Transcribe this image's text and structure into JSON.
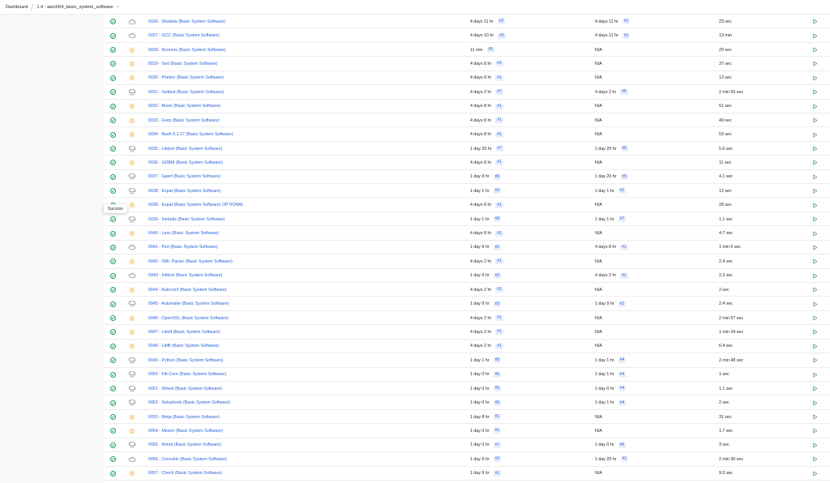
{
  "breadcrumb": {
    "items": [
      "Dashboard",
      "1.4 - aarch64_basic_system_software"
    ]
  },
  "tooltip": "Success",
  "colors": {
    "success": "#1f9d55",
    "link": "#2b62d8",
    "badge_bg": "#e8eefc"
  },
  "jobs": [
    {
      "name": "0026 - Shadow (Basic System Software)",
      "weather": "cloudy-icon",
      "last_success": "4 days 11 hr",
      "last_success_build": "#2",
      "last_failure": "4 days 11 hr",
      "last_failure_build": "#1",
      "last_duration": "23 sec"
    },
    {
      "name": "0027 - GCC (Basic System Software)",
      "weather": "cloudy-icon",
      "last_success": "4 days 10 hr",
      "last_success_build": "#3",
      "last_failure": "4 days 11 hr",
      "last_failure_build": "#1",
      "last_duration": "13 min"
    },
    {
      "name": "0028 - Ncurses (Basic System Software)",
      "weather": "sunny-icon",
      "last_success": "11 min",
      "last_success_build": "#5",
      "last_failure": "N/A",
      "last_failure_build": "",
      "last_duration": "29 sec"
    },
    {
      "name": "0029 - Sed (Basic System Software)",
      "weather": "sunny-icon",
      "last_success": "4 days 8 hr",
      "last_success_build": "#1",
      "last_failure": "N/A",
      "last_failure_build": "",
      "last_duration": "37 sec"
    },
    {
      "name": "0030 - Psmisc (Basic System Software)",
      "weather": "sunny-icon",
      "last_success": "4 days 8 hr",
      "last_success_build": "#1",
      "last_failure": "N/A",
      "last_failure_build": "",
      "last_duration": "13 sec"
    },
    {
      "name": "0031 - Gettext (Basic System Software)",
      "weather": "rainy-icon",
      "last_success": "4 days 2 hr",
      "last_success_build": "#7",
      "last_failure": "4 days 2 hr",
      "last_failure_build": "#5",
      "last_duration": "2 min 55 sec"
    },
    {
      "name": "0032 - Bison (Basic System Software)",
      "weather": "sunny-icon",
      "last_success": "4 days 8 hr",
      "last_success_build": "#1",
      "last_failure": "N/A",
      "last_failure_build": "",
      "last_duration": "51 sec"
    },
    {
      "name": "0033 - Grep (Basic System Software)",
      "weather": "sunny-icon",
      "last_success": "4 days 8 hr",
      "last_success_build": "#1",
      "last_failure": "N/A",
      "last_failure_build": "",
      "last_duration": "49 sec"
    },
    {
      "name": "0034 - Bash-5.2.37 (Basic System Software)",
      "weather": "sunny-icon",
      "last_success": "4 days 8 hr",
      "last_success_build": "#1",
      "last_failure": "N/A",
      "last_failure_build": "",
      "last_duration": "53 sec"
    },
    {
      "name": "0035 - Libtool (Basic System Software)",
      "weather": "rainy-icon",
      "last_success": "1 day 20 hr",
      "last_success_build": "#7",
      "last_failure": "1 day 20 hr",
      "last_failure_build": "#6",
      "last_duration": "5.6 sec"
    },
    {
      "name": "0036 - GDBM (Basic System Software)",
      "weather": "sunny-icon",
      "last_success": "4 days 8 hr",
      "last_success_build": "#1",
      "last_failure": "N/A",
      "last_failure_build": "",
      "last_duration": "11 sec"
    },
    {
      "name": "0037 - Gperf (Basic System Software)",
      "weather": "rainy-icon",
      "last_success": "1 day 9 hr",
      "last_success_build": "#6",
      "last_failure": "1 day 20 hr",
      "last_failure_build": "#5",
      "last_duration": "4.1 sec"
    },
    {
      "name": "0038 - Expat (Basic System Software)",
      "weather": "rainy-icon",
      "last_success": "1 day 1 hr",
      "last_success_build": "#3",
      "last_failure": "1 day 1 hr",
      "last_failure_build": "#2",
      "last_duration": "12 sec"
    },
    {
      "name": "0038 - Expat (Basic System Software) OPTIONAL",
      "weather": "sunny-icon",
      "last_success": "4 days 8 hr",
      "last_success_build": "#1",
      "last_failure": "N/A",
      "last_failure_build": "",
      "last_duration": "28 sec"
    },
    {
      "name": "0039 - Inetutils (Basic System Software)",
      "weather": "rainy-icon",
      "last_success": "1 day 1 hr",
      "last_success_build": "#8",
      "last_failure": "1 day 1 hr",
      "last_failure_build": "#7",
      "last_duration": "1.1 sec"
    },
    {
      "name": "0040 - Less (Basic System Software)",
      "weather": "sunny-icon",
      "last_success": "4 days 8 hr",
      "last_success_build": "#1",
      "last_failure": "N/A",
      "last_failure_build": "",
      "last_duration": "4.7 sec"
    },
    {
      "name": "0041 - Perl (Basic System Software)",
      "weather": "cloudy-icon",
      "last_success": "1 day 9 hr",
      "last_success_build": "#2",
      "last_failure": "4 days 8 hr",
      "last_failure_build": "#1",
      "last_duration": "1 min 6 sec"
    },
    {
      "name": "0042 - XML Parser (Basic System Software)",
      "weather": "sunny-icon",
      "last_success": "4 days 2 hr",
      "last_success_build": "#1",
      "last_failure": "N/A",
      "last_failure_build": "",
      "last_duration": "2.4 sec"
    },
    {
      "name": "0043 - Intltool (Basic System Software)",
      "weather": "cloudy-icon",
      "last_success": "1 day 9 hr",
      "last_success_build": "#2",
      "last_failure": "4 days 2 hr",
      "last_failure_build": "#1",
      "last_duration": "2.3 sec"
    },
    {
      "name": "0044 - Autoconf (Basic System Software)",
      "weather": "sunny-icon",
      "last_success": "4 days 2 hr",
      "last_success_build": "#1",
      "last_failure": "N/A",
      "last_failure_build": "",
      "last_duration": "2 sec"
    },
    {
      "name": "0045 - Automake (Basic System Software)",
      "weather": "rainy-icon",
      "last_success": "1 day 9 hr",
      "last_success_build": "#3",
      "last_failure": "1 day 9 hr",
      "last_failure_build": "#2",
      "last_duration": "2.4 sec"
    },
    {
      "name": "0046 - OpenSSL (Basic System Software)",
      "weather": "sunny-icon",
      "last_success": "4 days 2 hr",
      "last_success_build": "#1",
      "last_failure": "N/A",
      "last_failure_build": "",
      "last_duration": "2 min 57 sec"
    },
    {
      "name": "0047 - Libelf (Basic System Software)",
      "weather": "sunny-icon",
      "last_success": "4 days 2 hr",
      "last_success_build": "#1",
      "last_failure": "N/A",
      "last_failure_build": "",
      "last_duration": "1 min 34 sec"
    },
    {
      "name": "0048 - Libffi (Basic System Software)",
      "weather": "sunny-icon",
      "last_success": "4 days 2 hr",
      "last_success_build": "#1",
      "last_failure": "N/A",
      "last_failure_build": "",
      "last_duration": "6.4 sec"
    },
    {
      "name": "0049 - Python (Basic System Software)",
      "weather": "rainy-icon",
      "last_success": "1 day 1 hr",
      "last_success_build": "#5",
      "last_failure": "1 day 1 hr",
      "last_failure_build": "#4",
      "last_duration": "2 min 48 sec"
    },
    {
      "name": "0050 - Flit-Core (Basic System Software)",
      "weather": "rainy-icon",
      "last_success": "1 day 0 hr",
      "last_success_build": "#5",
      "last_failure": "1 day 1 hr",
      "last_failure_build": "#4",
      "last_duration": "1 sec"
    },
    {
      "name": "0051 - Wheel (Basic System Software)",
      "weather": "rainy-icon",
      "last_success": "1 day 0 hr",
      "last_success_build": "#5",
      "last_failure": "1 day 0 hr",
      "last_failure_build": "#4",
      "last_duration": "1.1 sec"
    },
    {
      "name": "0052 - Setuptools (Basic System Software)",
      "weather": "rainy-icon",
      "last_success": "1 day 0 hr",
      "last_success_build": "#5",
      "last_failure": "1 day 1 hr",
      "last_failure_build": "#4",
      "last_duration": "2 sec"
    },
    {
      "name": "0053 - Ninja (Basic System Software)",
      "weather": "sunny-icon",
      "last_success": "1 day 8 hr",
      "last_success_build": "#1",
      "last_failure": "N/A",
      "last_failure_build": "",
      "last_duration": "31 sec"
    },
    {
      "name": "0054 - Meson (Basic System Software)",
      "weather": "sunny-icon",
      "last_success": "1 day 0 hr",
      "last_success_build": "#1",
      "last_failure": "N/A",
      "last_failure_build": "",
      "last_duration": "1.7 sec"
    },
    {
      "name": "0055 - Kmod (Basic System Software)",
      "weather": "rainy-icon",
      "last_success": "1 day 0 hr",
      "last_success_build": "#7",
      "last_failure": "1 day 0 hr",
      "last_failure_build": "#6",
      "last_duration": "3 sec"
    },
    {
      "name": "0056 - Coreutils (Basic System Software)",
      "weather": "cloudy-icon",
      "last_success": "1 day 9 hr",
      "last_success_build": "#2",
      "last_failure": "1 day 20 hr",
      "last_failure_build": "#1",
      "last_duration": "2 min 30 sec"
    },
    {
      "name": "0057 - Check (Basic System Software)",
      "weather": "sunny-icon",
      "last_success": "1 day 9 hr",
      "last_success_build": "#1",
      "last_failure": "N/A",
      "last_failure_build": "",
      "last_duration": "9.5 sec"
    }
  ]
}
